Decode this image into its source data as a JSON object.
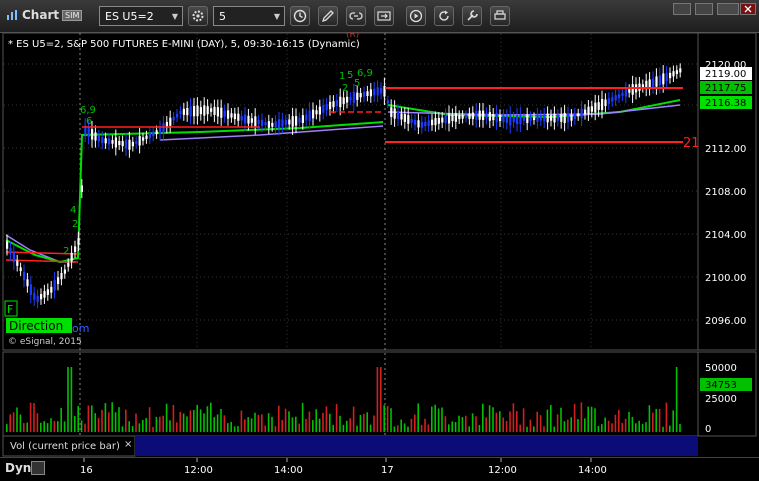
{
  "window": {
    "title": "Chart",
    "badge": "SIM"
  },
  "toolbar": {
    "symbol": "ES U5=2",
    "interval": "5"
  },
  "chart": {
    "header": "* ES U5=2, S&P 500 FUTURES E-MINI (DAY), 5, 09:30-16:15 (Dynamic)",
    "copyright": "© eSignal, 2015",
    "direction_label": "Direction",
    "direction_suffix": "om",
    "f_label": "F",
    "price_axis": [
      "2120.00",
      "2116.00",
      "2112.00",
      "2108.00",
      "2104.00",
      "2100.00",
      "2096.00"
    ],
    "price_labels": {
      "last": "2119.00",
      "level2": "2117.75",
      "level3": "2116.38"
    },
    "red_marker": "21",
    "top_marker": "(R)",
    "annotations": [
      "6,9",
      "6",
      "2",
      "4",
      "2",
      "1",
      "5",
      "6,9",
      "2",
      "5"
    ]
  },
  "volume": {
    "label": "Vol (current price bar)",
    "axis": [
      "50000",
      "25000",
      "0"
    ],
    "current": "34753",
    "close_label": "×"
  },
  "time_axis": [
    "16",
    "12:00",
    "14:00",
    "17",
    "12:00",
    "14:00"
  ],
  "footer": {
    "mode": "Dyn"
  },
  "colors": {
    "up": "#ffffff",
    "down": "#1e3cff",
    "green": "#00e000",
    "red": "#ff2020",
    "lavender": "#a080ff"
  }
}
